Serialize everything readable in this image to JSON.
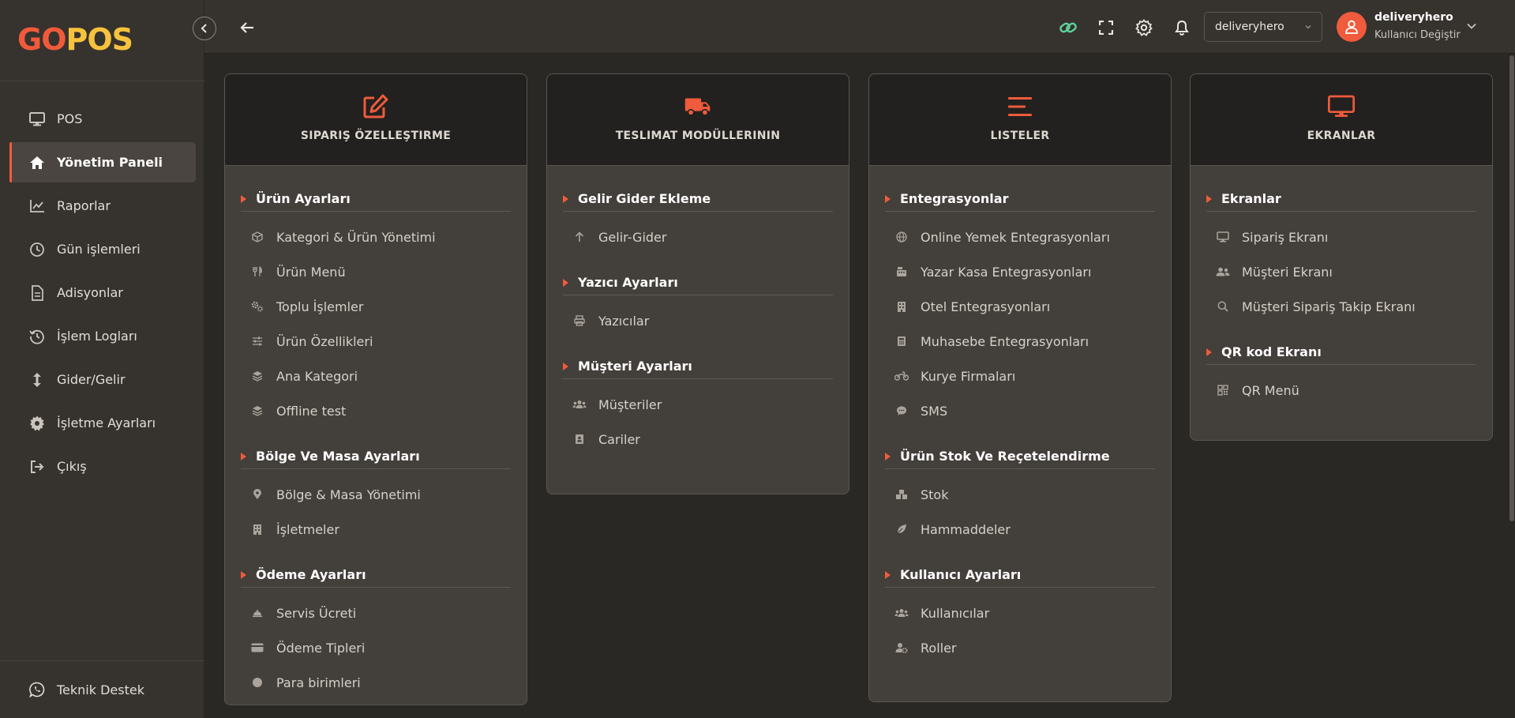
{
  "logo": {
    "part1": "GO",
    "part2": "POS"
  },
  "sidebar": {
    "items": [
      {
        "label": "POS",
        "icon": "monitor-icon"
      },
      {
        "label": "Yönetim Paneli",
        "icon": "home-icon",
        "active": true
      },
      {
        "label": "Raporlar",
        "icon": "chart-line-icon"
      },
      {
        "label": "Gün işlemleri",
        "icon": "clock-icon"
      },
      {
        "label": "Adisyonlar",
        "icon": "document-icon"
      },
      {
        "label": "İşlem Logları",
        "icon": "history-icon"
      },
      {
        "label": "Gider/Gelir",
        "icon": "arrows-vertical-icon"
      },
      {
        "label": "İşletme Ayarları",
        "icon": "gear-icon"
      },
      {
        "label": "Çıkış",
        "icon": "logout-icon"
      }
    ],
    "support_label": "Teknik Destek"
  },
  "topbar": {
    "venue_select": "deliveryhero",
    "user_name": "deliveryhero",
    "user_sub": "Kullanıcı Değiştir"
  },
  "colors": {
    "accent": "#ef5b3c",
    "link_icon": "#5dd39e",
    "logo_yellow": "#f6c23e"
  },
  "cards": [
    {
      "title": "SIPARIŞ ÖZELLEŞTIRME",
      "icon": "edit-icon",
      "sections": [
        {
          "title": "Ürün Ayarları",
          "items": [
            {
              "label": "Kategori & Ürün Yönetimi",
              "icon": "box-icon"
            },
            {
              "label": "Ürün Menü",
              "icon": "utensils-icon"
            },
            {
              "label": "Toplu İşlemler",
              "icon": "cogs-icon"
            },
            {
              "label": "Ürün Özellikleri",
              "icon": "sliders-icon"
            },
            {
              "label": "Ana Kategori",
              "icon": "layers-icon"
            },
            {
              "label": "Offline test",
              "icon": "layers-icon"
            }
          ]
        },
        {
          "title": "Bölge Ve Masa Ayarları",
          "items": [
            {
              "label": "Bölge & Masa Yönetimi",
              "icon": "map-pin-icon"
            },
            {
              "label": "İşletmeler",
              "icon": "building-icon"
            }
          ]
        },
        {
          "title": "Ödeme Ayarları",
          "items": [
            {
              "label": "Servis Ücreti",
              "icon": "bell-service-icon"
            },
            {
              "label": "Ödeme Tipleri",
              "icon": "credit-card-icon"
            },
            {
              "label": "Para birimleri",
              "icon": "coin-icon"
            }
          ]
        }
      ]
    },
    {
      "title": "TESLIMAT MODÜLLERININ",
      "icon": "truck-icon",
      "sections": [
        {
          "title": "Gelir Gider Ekleme",
          "items": [
            {
              "label": "Gelir-Gider",
              "icon": "arrow-up-icon"
            }
          ]
        },
        {
          "title": "Yazıcı Ayarları",
          "items": [
            {
              "label": "Yazıcılar",
              "icon": "printer-icon"
            }
          ]
        },
        {
          "title": "Müşteri Ayarları",
          "items": [
            {
              "label": "Müşteriler",
              "icon": "users-icon"
            },
            {
              "label": "Cariler",
              "icon": "address-book-icon"
            }
          ]
        }
      ]
    },
    {
      "title": "LISTELER",
      "icon": "list-icon",
      "sections": [
        {
          "title": "Entegrasyonlar",
          "items": [
            {
              "label": "Online Yemek Entegrasyonları",
              "icon": "globe-icon"
            },
            {
              "label": "Yazar Kasa Entegrasyonları",
              "icon": "cash-register-icon"
            },
            {
              "label": "Otel Entegrasyonları",
              "icon": "hotel-icon"
            },
            {
              "label": "Muhasebe Entegrasyonları",
              "icon": "calculator-icon"
            },
            {
              "label": "Kurye Firmaları",
              "icon": "motorcycle-icon"
            },
            {
              "label": "SMS",
              "icon": "chat-icon"
            }
          ]
        },
        {
          "title": "Ürün Stok Ve Reçetelendirme",
          "items": [
            {
              "label": "Stok",
              "icon": "boxes-icon"
            },
            {
              "label": "Hammaddeler",
              "icon": "leaf-icon"
            }
          ]
        },
        {
          "title": "Kullanıcı Ayarları",
          "items": [
            {
              "label": "Kullanıcılar",
              "icon": "users-icon"
            },
            {
              "label": "Roller",
              "icon": "user-cog-icon"
            }
          ]
        }
      ]
    },
    {
      "title": "EKRANLAR",
      "icon": "monitor-icon",
      "sections": [
        {
          "title": "Ekranlar",
          "items": [
            {
              "label": "Sipariş Ekranı",
              "icon": "monitor-small-icon"
            },
            {
              "label": "Müşteri Ekranı",
              "icon": "users-icon"
            },
            {
              "label": "Müşteri Sipariş Takip Ekranı",
              "icon": "search-icon"
            }
          ]
        },
        {
          "title": "QR kod Ekranı",
          "items": [
            {
              "label": "QR Menü",
              "icon": "qr-icon"
            }
          ]
        }
      ]
    }
  ]
}
